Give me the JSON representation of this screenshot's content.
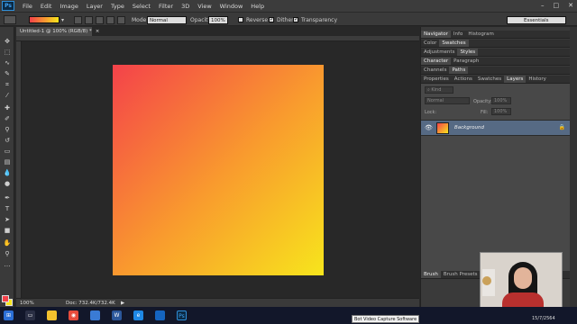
{
  "menubar": {
    "logo": "Ps",
    "items": [
      "File",
      "Edit",
      "Image",
      "Layer",
      "Type",
      "Select",
      "Filter",
      "3D",
      "View",
      "Window",
      "Help"
    ],
    "window_controls": [
      "–",
      "□",
      "✕"
    ]
  },
  "options": {
    "mode_label": "Mode:",
    "mode_value": "Normal",
    "opacity_label": "Opacity:",
    "opacity_value": "100%",
    "reverse_label": "Reverse",
    "reverse_checked": false,
    "dither_label": "Dither",
    "dither_checked": true,
    "transparency_label": "Transparency",
    "transparency_checked": true,
    "workspace": "Essentials",
    "gradient_start": "#f4424a",
    "gradient_end": "#f7e51c"
  },
  "document": {
    "tab_title": "Untitled-1 @ 100% (RGB/8) *",
    "tab_close": "×",
    "canvas_gradient": [
      "#f4424a",
      "#f99a2e",
      "#f7e51c"
    ]
  },
  "status": {
    "zoom": "100%",
    "doc_info": "Doc: 732.4K/732.4K",
    "arrow": "▶"
  },
  "panels": {
    "group1_tabs": [
      "Navigator",
      "Info",
      "Histogram"
    ],
    "group2_tabs": [
      "Color",
      "Swatches"
    ],
    "group3_tabs": [
      "Adjustments",
      "Styles"
    ],
    "group4_tabs": [
      "Character",
      "Paragraph"
    ],
    "group5_tabs": [
      "Channels",
      "Paths"
    ],
    "layers_tabs": [
      "Properties",
      "Actions",
      "Swatches",
      "Layers",
      "History"
    ],
    "kind_label": "Kind",
    "blend_mode": "Normal",
    "opacity_label": "Opacity:",
    "opacity_value": "100%",
    "lock_label": "Lock:",
    "fill_label": "Fill:",
    "fill_value": "100%",
    "layer_name": "Background",
    "brush_tabs": [
      "Brush",
      "Brush Presets"
    ]
  },
  "tools": {
    "icons": [
      "move-icon",
      "marquee-icon",
      "lasso-icon",
      "quick-select-icon",
      "crop-icon",
      "eyedropper-icon",
      "healing-icon",
      "brush-icon",
      "clone-stamp-icon",
      "history-brush-icon",
      "eraser-icon",
      "gradient-icon",
      "blur-icon",
      "dodge-icon",
      "pen-icon",
      "type-icon",
      "path-select-icon",
      "shape-icon",
      "hand-icon",
      "zoom-icon"
    ],
    "foreground_color": "#f4424a",
    "background_color": "#f7e51c"
  },
  "taskbar": {
    "tooltip": "Bot Video Capture Software",
    "date": "15/7/2564"
  }
}
